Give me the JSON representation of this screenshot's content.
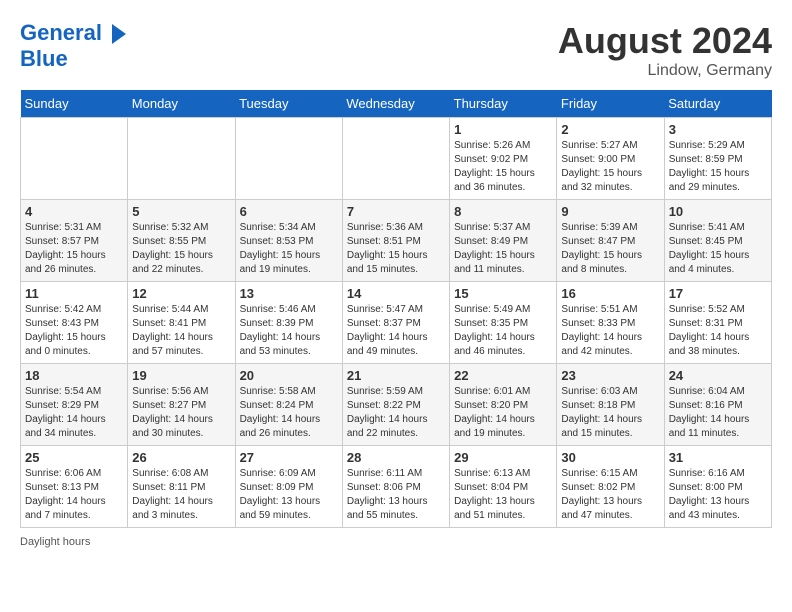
{
  "header": {
    "logo_line1": "General",
    "logo_line2": "Blue",
    "month_year": "August 2024",
    "location": "Lindow, Germany"
  },
  "days_of_week": [
    "Sunday",
    "Monday",
    "Tuesday",
    "Wednesday",
    "Thursday",
    "Friday",
    "Saturday"
  ],
  "weeks": [
    [
      {
        "day": "",
        "info": ""
      },
      {
        "day": "",
        "info": ""
      },
      {
        "day": "",
        "info": ""
      },
      {
        "day": "",
        "info": ""
      },
      {
        "day": "1",
        "info": "Sunrise: 5:26 AM\nSunset: 9:02 PM\nDaylight: 15 hours and 36 minutes."
      },
      {
        "day": "2",
        "info": "Sunrise: 5:27 AM\nSunset: 9:00 PM\nDaylight: 15 hours and 32 minutes."
      },
      {
        "day": "3",
        "info": "Sunrise: 5:29 AM\nSunset: 8:59 PM\nDaylight: 15 hours and 29 minutes."
      }
    ],
    [
      {
        "day": "4",
        "info": "Sunrise: 5:31 AM\nSunset: 8:57 PM\nDaylight: 15 hours and 26 minutes."
      },
      {
        "day": "5",
        "info": "Sunrise: 5:32 AM\nSunset: 8:55 PM\nDaylight: 15 hours and 22 minutes."
      },
      {
        "day": "6",
        "info": "Sunrise: 5:34 AM\nSunset: 8:53 PM\nDaylight: 15 hours and 19 minutes."
      },
      {
        "day": "7",
        "info": "Sunrise: 5:36 AM\nSunset: 8:51 PM\nDaylight: 15 hours and 15 minutes."
      },
      {
        "day": "8",
        "info": "Sunrise: 5:37 AM\nSunset: 8:49 PM\nDaylight: 15 hours and 11 minutes."
      },
      {
        "day": "9",
        "info": "Sunrise: 5:39 AM\nSunset: 8:47 PM\nDaylight: 15 hours and 8 minutes."
      },
      {
        "day": "10",
        "info": "Sunrise: 5:41 AM\nSunset: 8:45 PM\nDaylight: 15 hours and 4 minutes."
      }
    ],
    [
      {
        "day": "11",
        "info": "Sunrise: 5:42 AM\nSunset: 8:43 PM\nDaylight: 15 hours and 0 minutes."
      },
      {
        "day": "12",
        "info": "Sunrise: 5:44 AM\nSunset: 8:41 PM\nDaylight: 14 hours and 57 minutes."
      },
      {
        "day": "13",
        "info": "Sunrise: 5:46 AM\nSunset: 8:39 PM\nDaylight: 14 hours and 53 minutes."
      },
      {
        "day": "14",
        "info": "Sunrise: 5:47 AM\nSunset: 8:37 PM\nDaylight: 14 hours and 49 minutes."
      },
      {
        "day": "15",
        "info": "Sunrise: 5:49 AM\nSunset: 8:35 PM\nDaylight: 14 hours and 46 minutes."
      },
      {
        "day": "16",
        "info": "Sunrise: 5:51 AM\nSunset: 8:33 PM\nDaylight: 14 hours and 42 minutes."
      },
      {
        "day": "17",
        "info": "Sunrise: 5:52 AM\nSunset: 8:31 PM\nDaylight: 14 hours and 38 minutes."
      }
    ],
    [
      {
        "day": "18",
        "info": "Sunrise: 5:54 AM\nSunset: 8:29 PM\nDaylight: 14 hours and 34 minutes."
      },
      {
        "day": "19",
        "info": "Sunrise: 5:56 AM\nSunset: 8:27 PM\nDaylight: 14 hours and 30 minutes."
      },
      {
        "day": "20",
        "info": "Sunrise: 5:58 AM\nSunset: 8:24 PM\nDaylight: 14 hours and 26 minutes."
      },
      {
        "day": "21",
        "info": "Sunrise: 5:59 AM\nSunset: 8:22 PM\nDaylight: 14 hours and 22 minutes."
      },
      {
        "day": "22",
        "info": "Sunrise: 6:01 AM\nSunset: 8:20 PM\nDaylight: 14 hours and 19 minutes."
      },
      {
        "day": "23",
        "info": "Sunrise: 6:03 AM\nSunset: 8:18 PM\nDaylight: 14 hours and 15 minutes."
      },
      {
        "day": "24",
        "info": "Sunrise: 6:04 AM\nSunset: 8:16 PM\nDaylight: 14 hours and 11 minutes."
      }
    ],
    [
      {
        "day": "25",
        "info": "Sunrise: 6:06 AM\nSunset: 8:13 PM\nDaylight: 14 hours and 7 minutes."
      },
      {
        "day": "26",
        "info": "Sunrise: 6:08 AM\nSunset: 8:11 PM\nDaylight: 14 hours and 3 minutes."
      },
      {
        "day": "27",
        "info": "Sunrise: 6:09 AM\nSunset: 8:09 PM\nDaylight: 13 hours and 59 minutes."
      },
      {
        "day": "28",
        "info": "Sunrise: 6:11 AM\nSunset: 8:06 PM\nDaylight: 13 hours and 55 minutes."
      },
      {
        "day": "29",
        "info": "Sunrise: 6:13 AM\nSunset: 8:04 PM\nDaylight: 13 hours and 51 minutes."
      },
      {
        "day": "30",
        "info": "Sunrise: 6:15 AM\nSunset: 8:02 PM\nDaylight: 13 hours and 47 minutes."
      },
      {
        "day": "31",
        "info": "Sunrise: 6:16 AM\nSunset: 8:00 PM\nDaylight: 13 hours and 43 minutes."
      }
    ]
  ],
  "footer": {
    "daylight_label": "Daylight hours"
  }
}
